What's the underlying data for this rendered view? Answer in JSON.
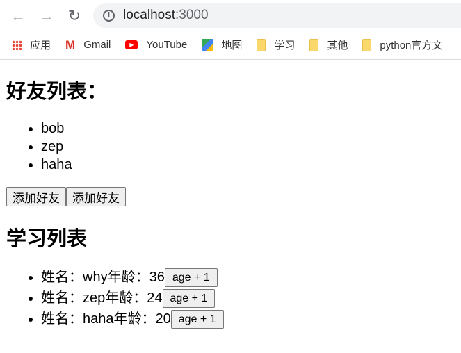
{
  "browser": {
    "url_host": "localhost",
    "url_port": ":3000",
    "bookmarks": [
      {
        "label": "应用",
        "icon": "apps-grid-icon"
      },
      {
        "label": "Gmail",
        "icon": "gmail-icon"
      },
      {
        "label": "YouTube",
        "icon": "youtube-icon"
      },
      {
        "label": "地图",
        "icon": "maps-icon"
      },
      {
        "label": "学习",
        "icon": "folder-icon"
      },
      {
        "label": "其他",
        "icon": "folder-icon"
      },
      {
        "label": "python官方文",
        "icon": "folder-icon"
      }
    ]
  },
  "friends": {
    "title": "好友列表：",
    "items": [
      "bob",
      "zep",
      "haha"
    ],
    "buttons": [
      "添加好友",
      "添加好友"
    ]
  },
  "study": {
    "title": "学习列表",
    "items": [
      {
        "text": "姓名：why年龄：36",
        "button": "age + 1"
      },
      {
        "text": "姓名：zep年龄：24",
        "button": "age + 1"
      },
      {
        "text": "姓名：haha年龄：20",
        "button": "age + 1"
      }
    ]
  }
}
